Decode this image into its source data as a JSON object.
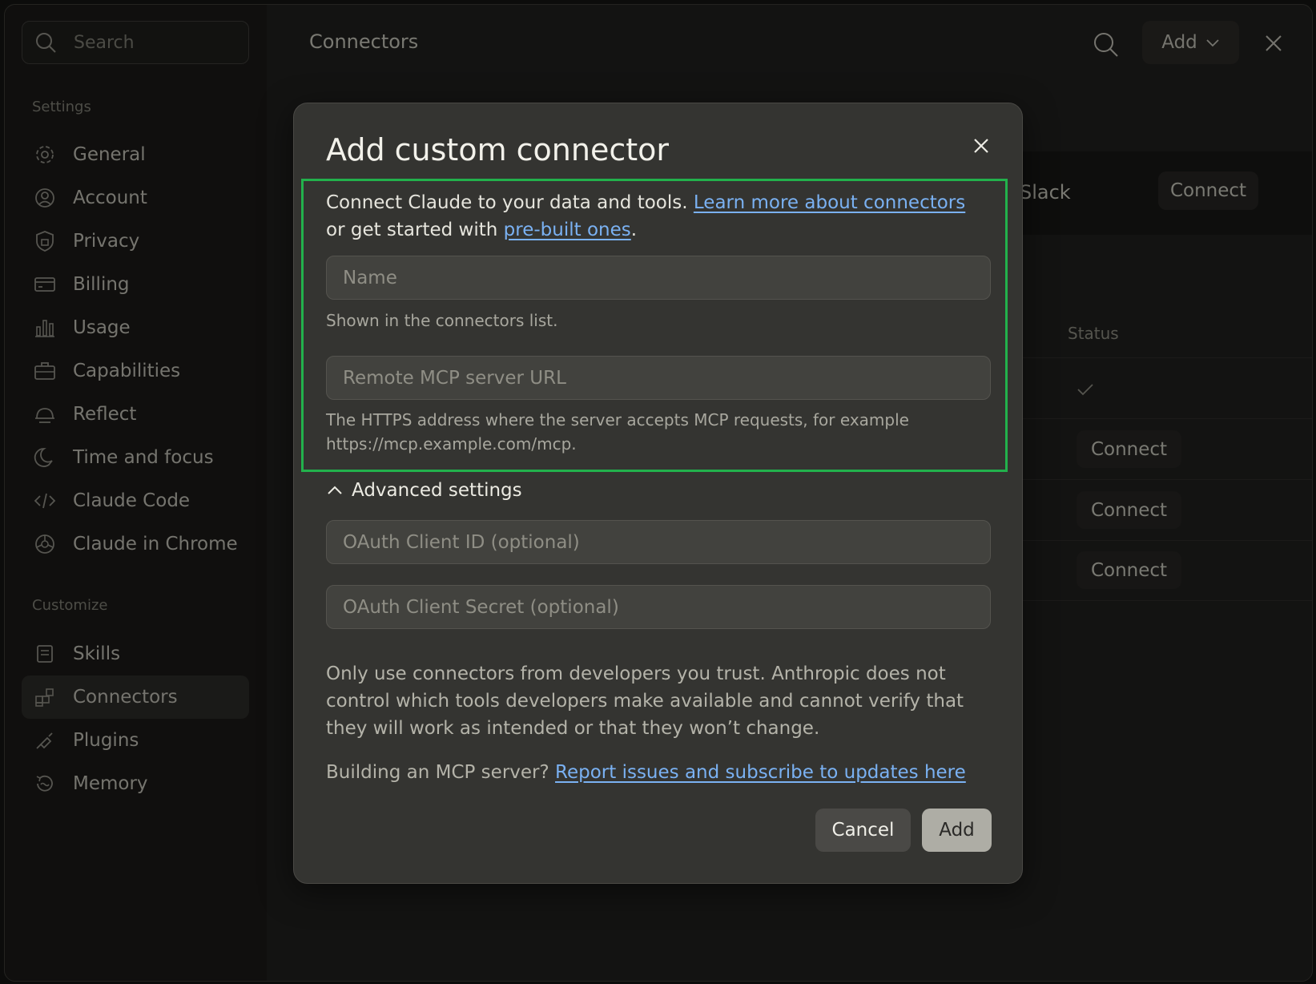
{
  "sidebar": {
    "search_placeholder": "Search",
    "settings_label": "Settings",
    "settings_items": [
      {
        "label": "General",
        "icon": "gear-icon"
      },
      {
        "label": "Account",
        "icon": "user-icon"
      },
      {
        "label": "Privacy",
        "icon": "shield-icon"
      },
      {
        "label": "Billing",
        "icon": "credit-card-icon"
      },
      {
        "label": "Usage",
        "icon": "bar-chart-icon"
      },
      {
        "label": "Capabilities",
        "icon": "briefcase-icon"
      },
      {
        "label": "Reflect",
        "icon": "dome-icon"
      },
      {
        "label": "Time and focus",
        "icon": "moon-icon"
      },
      {
        "label": "Claude Code",
        "icon": "code-icon"
      },
      {
        "label": "Claude in Chrome",
        "icon": "globe-icon"
      }
    ],
    "customize_label": "Customize",
    "customize_items": [
      {
        "label": "Skills",
        "icon": "scroll-icon"
      },
      {
        "label": "Connectors",
        "icon": "blocks-icon",
        "active": true
      },
      {
        "label": "Plugins",
        "icon": "plug-icon"
      },
      {
        "label": "Memory",
        "icon": "history-icon"
      }
    ]
  },
  "main": {
    "title": "Connectors",
    "add_label": "Add",
    "slack_label": "Slack",
    "connect_label": "Connect",
    "status_header": "Status"
  },
  "modal": {
    "title": "Add custom connector",
    "intro_prefix": "Connect Claude to your data and tools. ",
    "intro_link1": "Learn more about connectors",
    "intro_mid": " or get started with ",
    "intro_link2": "pre-built ones",
    "intro_suffix": ".",
    "name_placeholder": "Name",
    "name_hint": "Shown in the connectors list.",
    "url_placeholder": "Remote MCP server URL",
    "url_hint": "The HTTPS address where the server accepts MCP requests, for example https://mcp.example.com/mcp.",
    "advanced_label": "Advanced settings",
    "client_id_placeholder": "OAuth Client ID (optional)",
    "client_secret_placeholder": "OAuth Client Secret (optional)",
    "notice": "Only use connectors from developers you trust. Anthropic does not control which tools developers make available and cannot verify that they will work as intended or that they won’t change.",
    "build_prefix": "Building an MCP server? ",
    "build_link": "Report issues and subscribe to updates here",
    "cancel_label": "Cancel",
    "add_label": "Add"
  },
  "colors": {
    "highlight": "#22b14c",
    "link": "#7ab1f2"
  }
}
